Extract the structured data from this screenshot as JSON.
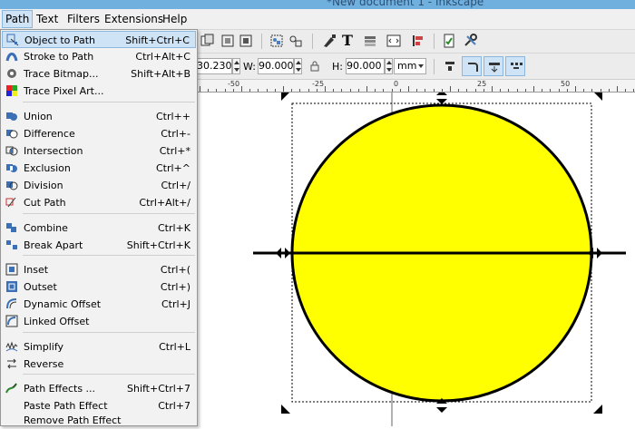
{
  "window": {
    "title": "*New document 1 - Inkscape"
  },
  "menubar": {
    "items": [
      "Path",
      "Text",
      "Filters",
      "Extensions",
      "Help"
    ]
  },
  "controls": {
    "x_value": "30.230",
    "w_label": "W:",
    "w_value": "90.000",
    "h_label": "H:",
    "h_value": "90.000",
    "unit": "mm"
  },
  "ruler": {
    "labels": [
      "-50",
      "-25",
      "0",
      "25",
      "50"
    ]
  },
  "path_menu": {
    "items": [
      {
        "label": "Object to Path",
        "shortcut": "Shift+Ctrl+C",
        "icon": "object-to-path-icon",
        "highlighted": true
      },
      {
        "label": "Stroke to Path",
        "shortcut": "Ctrl+Alt+C",
        "icon": "stroke-to-path-icon"
      },
      {
        "label": "Trace Bitmap...",
        "shortcut": "Shift+Alt+B",
        "icon": "trace-bitmap-icon"
      },
      {
        "label": "Trace Pixel Art...",
        "shortcut": "",
        "icon": "trace-pixel-art-icon"
      },
      {
        "label": "Union",
        "shortcut": "Ctrl++",
        "icon": "union-icon"
      },
      {
        "label": "Difference",
        "shortcut": "Ctrl+-",
        "icon": "difference-icon"
      },
      {
        "label": "Intersection",
        "shortcut": "Ctrl+*",
        "icon": "intersection-icon"
      },
      {
        "label": "Exclusion",
        "shortcut": "Ctrl+^",
        "icon": "exclusion-icon"
      },
      {
        "label": "Division",
        "shortcut": "Ctrl+/",
        "icon": "division-icon"
      },
      {
        "label": "Cut Path",
        "shortcut": "Ctrl+Alt+/",
        "icon": "cut-path-icon"
      },
      {
        "label": "Combine",
        "shortcut": "Ctrl+K",
        "icon": "combine-icon"
      },
      {
        "label": "Break Apart",
        "shortcut": "Shift+Ctrl+K",
        "icon": "break-apart-icon"
      },
      {
        "label": "Inset",
        "shortcut": "Ctrl+(",
        "icon": "inset-icon"
      },
      {
        "label": "Outset",
        "shortcut": "Ctrl+)",
        "icon": "outset-icon"
      },
      {
        "label": "Dynamic Offset",
        "shortcut": "Ctrl+J",
        "icon": "dynamic-offset-icon"
      },
      {
        "label": "Linked Offset",
        "shortcut": "",
        "icon": "linked-offset-icon"
      },
      {
        "label": "Simplify",
        "shortcut": "Ctrl+L",
        "icon": "simplify-icon"
      },
      {
        "label": "Reverse",
        "shortcut": "",
        "icon": "reverse-icon"
      },
      {
        "label": "Path Effects ...",
        "shortcut": "Shift+Ctrl+7",
        "icon": "path-effects-icon"
      },
      {
        "label": "Paste Path Effect",
        "shortcut": "Ctrl+7",
        "icon": ""
      },
      {
        "label": "Remove Path Effect",
        "shortcut": "",
        "icon": ""
      }
    ]
  },
  "colors": {
    "fill": "#ffff00",
    "stroke": "#000000",
    "menu_highlight": "#cfe3f6"
  }
}
